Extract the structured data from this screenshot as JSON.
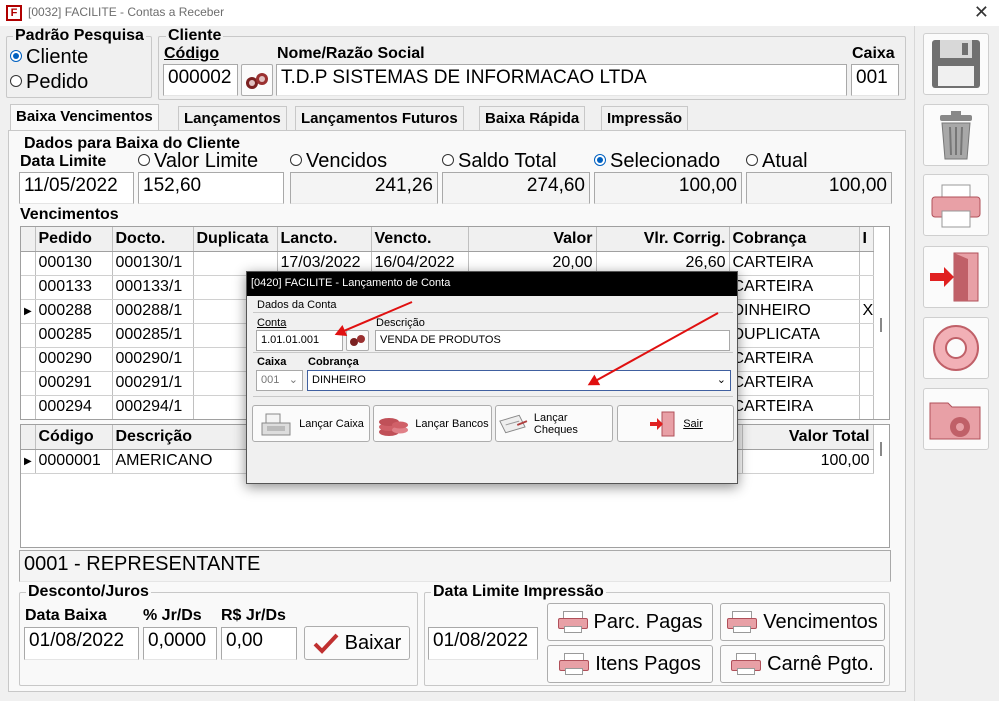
{
  "window": {
    "title": "[0032] FACILITE - Contas a Receber",
    "close_glyph": "✕"
  },
  "padrao": {
    "legend": "Padrão Pesquisa",
    "options": [
      {
        "label": "Cliente",
        "selected": true
      },
      {
        "label": "Pedido",
        "selected": false
      }
    ]
  },
  "cliente": {
    "legend": "Cliente",
    "codigo_label": "Código",
    "codigo": "000002",
    "nome_label": "Nome/Razão Social",
    "nome": "T.D.P SISTEMAS DE INFORMACAO LTDA",
    "caixa_label": "Caixa",
    "caixa": "001"
  },
  "tabs": [
    "Baixa Vencimentos",
    "Lançamentos",
    "Lançamentos Futuros",
    "Baixa Rápida",
    "Impressão"
  ],
  "dados": {
    "legend": "Dados para Baixa do Cliente",
    "data_limite_label": "Data Limite",
    "data_limite": "11/05/2022",
    "valor_limite_label": "Valor Limite",
    "valor_limite": "152,60",
    "vencidos_label": "Vencidos",
    "vencidos": "241,26",
    "saldo_label": "Saldo Total",
    "saldo": "274,60",
    "selecionado_label": "Selecionado",
    "selecionado": "100,00",
    "atual_label": "Atual",
    "atual": "100,00"
  },
  "vencimentos": {
    "label": "Vencimentos",
    "columns": [
      "Pedido",
      "Docto.",
      "Duplicata",
      "Lancto.",
      "Vencto.",
      "Valor",
      "Vlr. Corrig.",
      "Cobrança",
      "I"
    ],
    "rows": [
      [
        "000130",
        "000130/1",
        "",
        "17/03/2022",
        "16/04/2022",
        "20,00",
        "26,60",
        "CARTEIRA",
        ""
      ],
      [
        "000133",
        "000133/1",
        "",
        "",
        "",
        "",
        "",
        "CARTEIRA",
        ""
      ],
      [
        "000288",
        "000288/1",
        "",
        "",
        "",
        "",
        "",
        "DINHEIRO",
        "X"
      ],
      [
        "000285",
        "000285/1",
        "",
        "",
        "",
        "",
        "",
        "DUPLICATA",
        ""
      ],
      [
        "000290",
        "000290/1",
        "",
        "",
        "",
        "",
        "",
        "CARTEIRA",
        ""
      ],
      [
        "000291",
        "000291/1",
        "",
        "",
        "",
        "",
        "",
        "CARTEIRA",
        ""
      ],
      [
        "000294",
        "000294/1",
        "",
        "",
        "",
        "",
        "",
        "CARTEIRA",
        ""
      ]
    ]
  },
  "itens": {
    "columns": [
      "Código",
      "Descrição",
      "Valor Total"
    ],
    "rows": [
      [
        "0000001",
        "AMERICANO",
        "100,00"
      ]
    ]
  },
  "representante": "0001 - REPRESENTANTE",
  "desconto": {
    "legend": "Desconto/Juros",
    "data_baixa_label": "Data Baixa",
    "data_baixa": "01/08/2022",
    "jr_pct_label": "% Jr/Ds",
    "jr_pct": "0,0000",
    "jr_val_label": "R$ Jr/Ds",
    "jr_val": "0,00",
    "baixar_label": "Baixar"
  },
  "impressao": {
    "legend": "Data Limite Impressão",
    "data": "01/08/2022",
    "buttons": [
      "Parc. Pagas",
      "Vencimentos",
      "Itens Pagos",
      "Carnê Pgto."
    ]
  },
  "sidebar_icons": [
    "save-icon",
    "trash-icon",
    "printer-icon",
    "exit-door-icon",
    "help-lifebuoy-icon",
    "settings-folder-icon"
  ],
  "dialog": {
    "title": "[0420] FACILITE - Lançamento de Conta",
    "legend": "Dados da Conta",
    "conta_label": "Conta",
    "conta": "1.01.01.001",
    "descricao_label": "Descrição",
    "descricao": "VENDA DE PRODUTOS",
    "caixa_label": "Caixa",
    "caixa": "001",
    "cobranca_label": "Cobrança",
    "cobranca": "DINHEIRO",
    "buttons": [
      "Lançar Caixa",
      "Lançar Bancos",
      "Lançar Cheques",
      "Sair"
    ]
  },
  "colors": {
    "accent": "#0060c0",
    "arrow": "#e01010",
    "dialog_title_bg": "#000000"
  }
}
